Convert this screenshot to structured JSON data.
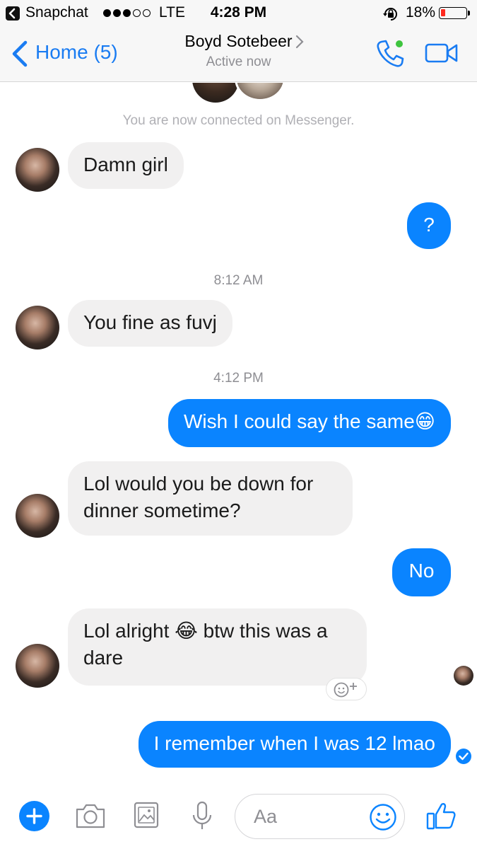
{
  "status_bar": {
    "app": "Snapchat",
    "carrier": "LTE",
    "time": "4:28 PM",
    "battery_label": "18%",
    "battery_level": 0.18,
    "battery_color": "#ff2a1f"
  },
  "nav": {
    "back_label": "Home (5)",
    "contact_name": "Boyd Sotebeer",
    "status": "Active now",
    "accent": "#1a7cf2"
  },
  "chat": {
    "connected_note": "You are now connected on Messenger.",
    "messages": [
      {
        "dir": "in",
        "text": "Damn girl"
      },
      {
        "dir": "out",
        "text": "?"
      },
      {
        "type": "time",
        "text": "8:12 AM"
      },
      {
        "dir": "in",
        "text": "You fine as fuvj"
      },
      {
        "type": "time",
        "text": "4:12 PM"
      },
      {
        "dir": "out",
        "text": "Wish I could say the same😁"
      },
      {
        "dir": "in",
        "text": "Lol would you be down for dinner sometime?"
      },
      {
        "dir": "out",
        "text": "No"
      },
      {
        "dir": "in",
        "text": "Lol alright 😂 btw this was a dare"
      },
      {
        "dir": "out",
        "text": "I remember when I was 12 lmao"
      }
    ],
    "incoming_bubble_color": "#f1f0f0",
    "outgoing_bubble_color": "#0a84ff"
  },
  "composer": {
    "placeholder": "Aa"
  },
  "icons": [
    "snapchat-back-icon",
    "lock-rotation-icon",
    "back-chevron-icon",
    "phone-icon",
    "video-camera-icon",
    "add-reaction-icon",
    "seen-avatar",
    "delivered-check-icon",
    "plus-icon",
    "camera-icon",
    "image-icon",
    "microphone-icon",
    "emoji-icon",
    "thumbs-up-icon"
  ]
}
